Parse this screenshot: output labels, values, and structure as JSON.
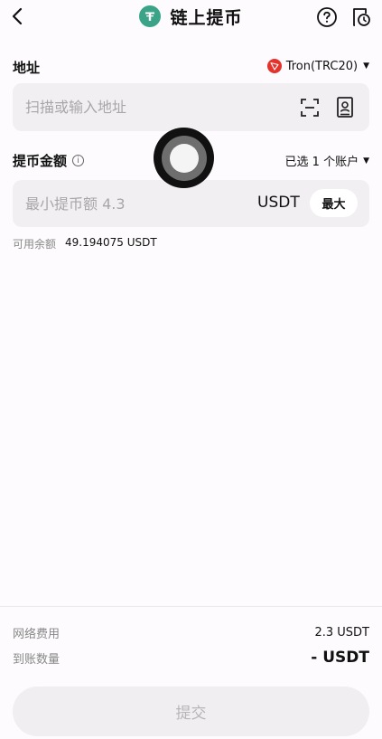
{
  "header": {
    "title": "链上提币",
    "back_icon": "chevron-left-icon",
    "help_icon": "question-circle-icon",
    "history_icon": "history-document-icon",
    "coin_icon": "usdt-tether-icon",
    "coin_color": "#3aa388"
  },
  "address": {
    "label": "地址",
    "network": "Tron(TRC20)",
    "network_icon_color": "#e5322b",
    "placeholder": "扫描或输入地址",
    "value": "",
    "scan_icon": "scan-icon",
    "address_book_icon": "address-book-icon"
  },
  "amount": {
    "label": "提币金额",
    "account_select": "已选 1 个账户",
    "placeholder": "最小提币额 4.3",
    "value": "",
    "unit": "USDT",
    "max_label": "最大",
    "balance_label": "可用余额",
    "balance_value": "49.194075 USDT"
  },
  "footer": {
    "fee_label": "网络费用",
    "fee_value": "2.3 USDT",
    "receive_label": "到账数量",
    "receive_value": "- USDT",
    "submit_label": "提交"
  }
}
